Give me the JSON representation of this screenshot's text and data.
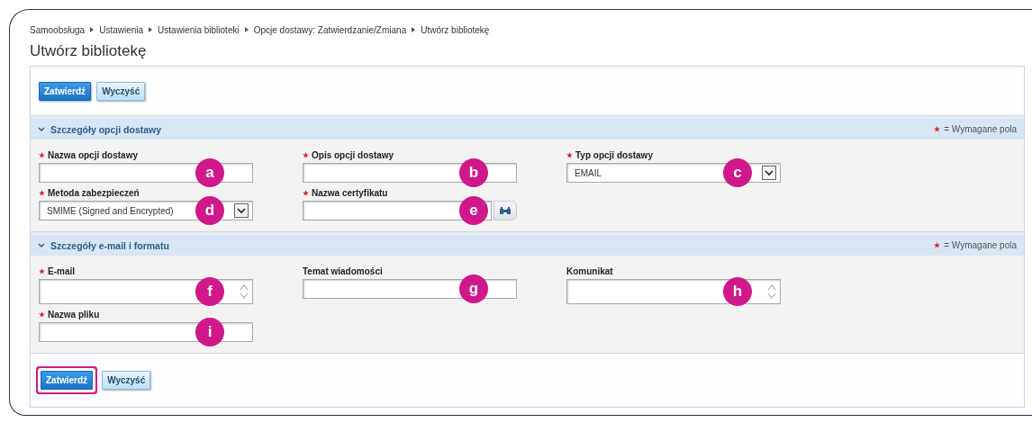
{
  "breadcrumb": [
    "Samoobsługa",
    "Ustawienia",
    "Ustawienia biblioteki",
    "Opcje dostawy: Zatwierdzanie/Zmiana",
    "Utwórz bibliotekę"
  ],
  "title": "Utwórz bibliotekę",
  "top_buttons": [
    {
      "label": "Zatwierdź",
      "kind": "primary",
      "highlighted": false
    },
    {
      "label": "Wyczyść",
      "kind": "secondary",
      "highlighted": false
    }
  ],
  "sections": [
    {
      "title": "Szczegóły opcji dostawy",
      "expanded": true,
      "legend": "= Wymagane pola",
      "rows": [
        [
          {
            "label": "Nazwa opcji dostawy",
            "required": true,
            "kind": "text",
            "marker": "a"
          },
          {
            "label": "Opis opcji dostawy",
            "required": true,
            "kind": "text",
            "marker": "b"
          },
          {
            "label": "Typ opcji dostawy",
            "required": true,
            "kind": "select",
            "value": "EMAIL",
            "marker": "c"
          }
        ],
        [
          {
            "label": "Metoda zabezpieczeń",
            "required": true,
            "kind": "select",
            "value": "SMIME (Signed and Encrypted)",
            "marker": "d"
          },
          {
            "label": "Nazwa certyfikatu",
            "required": true,
            "kind": "lookup",
            "marker": "e"
          }
        ]
      ]
    },
    {
      "title": "Szczegóły e-mail i formatu",
      "expanded": true,
      "legend": "= Wymagane pola",
      "rows": [
        [
          {
            "label": "E-mail",
            "required": true,
            "kind": "textarea",
            "marker": "f"
          },
          {
            "label": "Temat wiadomości",
            "required": false,
            "kind": "text",
            "marker": "g"
          },
          {
            "label": "Komunikat",
            "required": false,
            "kind": "textarea",
            "marker": "h"
          }
        ],
        [
          {
            "label": "Nazwa pliku",
            "required": true,
            "kind": "text",
            "marker": "i"
          }
        ]
      ]
    }
  ],
  "bottom_buttons": [
    {
      "label": "Zatwierdź",
      "kind": "primary",
      "highlighted": true
    },
    {
      "label": "Wyczyść",
      "kind": "secondary",
      "highlighted": false
    }
  ]
}
